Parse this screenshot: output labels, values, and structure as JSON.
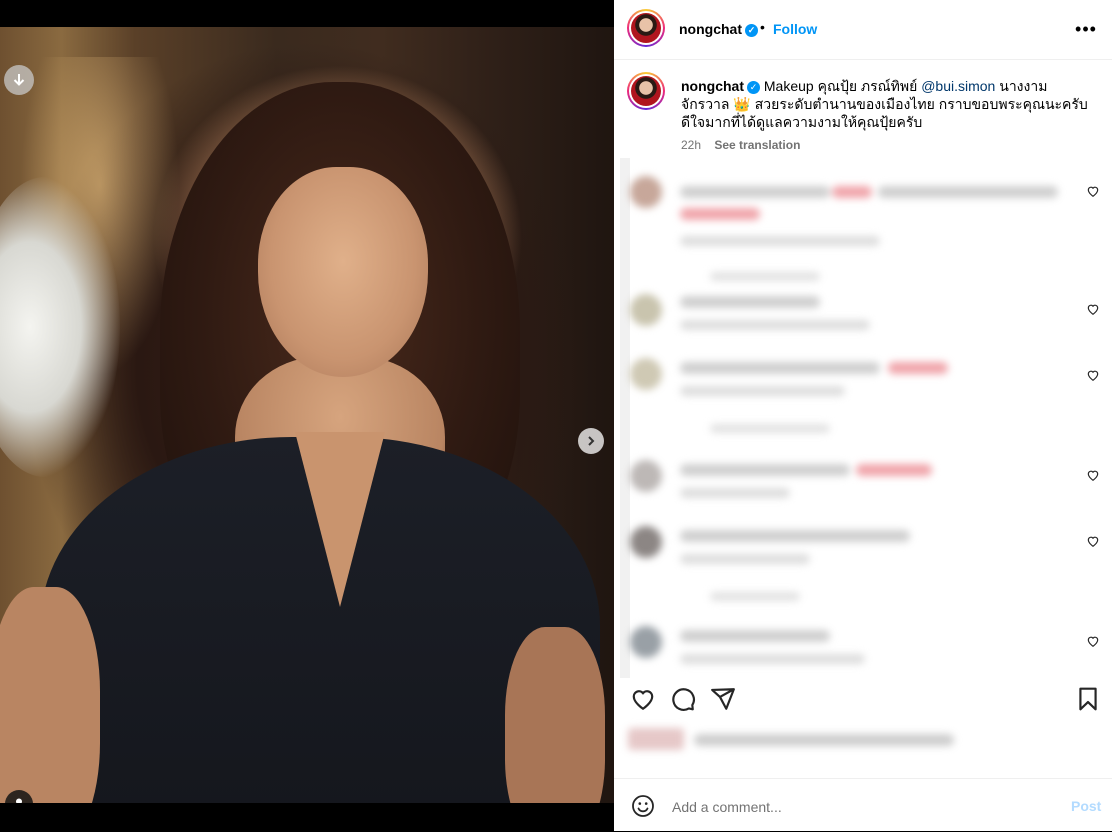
{
  "post": {
    "username": "nongchat",
    "verified_mark": "✓",
    "bullet": "•",
    "follow_label": "Follow",
    "more_icon": "•••",
    "caption_text_before_mention": "Makeup คุณปุ้ย ภรณ์ทิพย์ ",
    "caption_mention": "@bui.simon",
    "caption_text_after_mention": " นางงามจักรวาล 👑 สวยระดับตำนานของเมืองไทย กราบขอบพระคุณนะครับ ดีใจมากที่ได้ดูแลความงามให้คุณปุ้ยครับ",
    "time_ago": "22h",
    "see_translation": "See translation"
  },
  "media": {
    "slide_count": 2,
    "active_slide": 1
  },
  "comment_box": {
    "placeholder": "Add a comment...",
    "post_label": "Post"
  },
  "colors": {
    "accent": "#0095f6",
    "post_disabled": "#b3dbff",
    "muted": "#737373"
  }
}
